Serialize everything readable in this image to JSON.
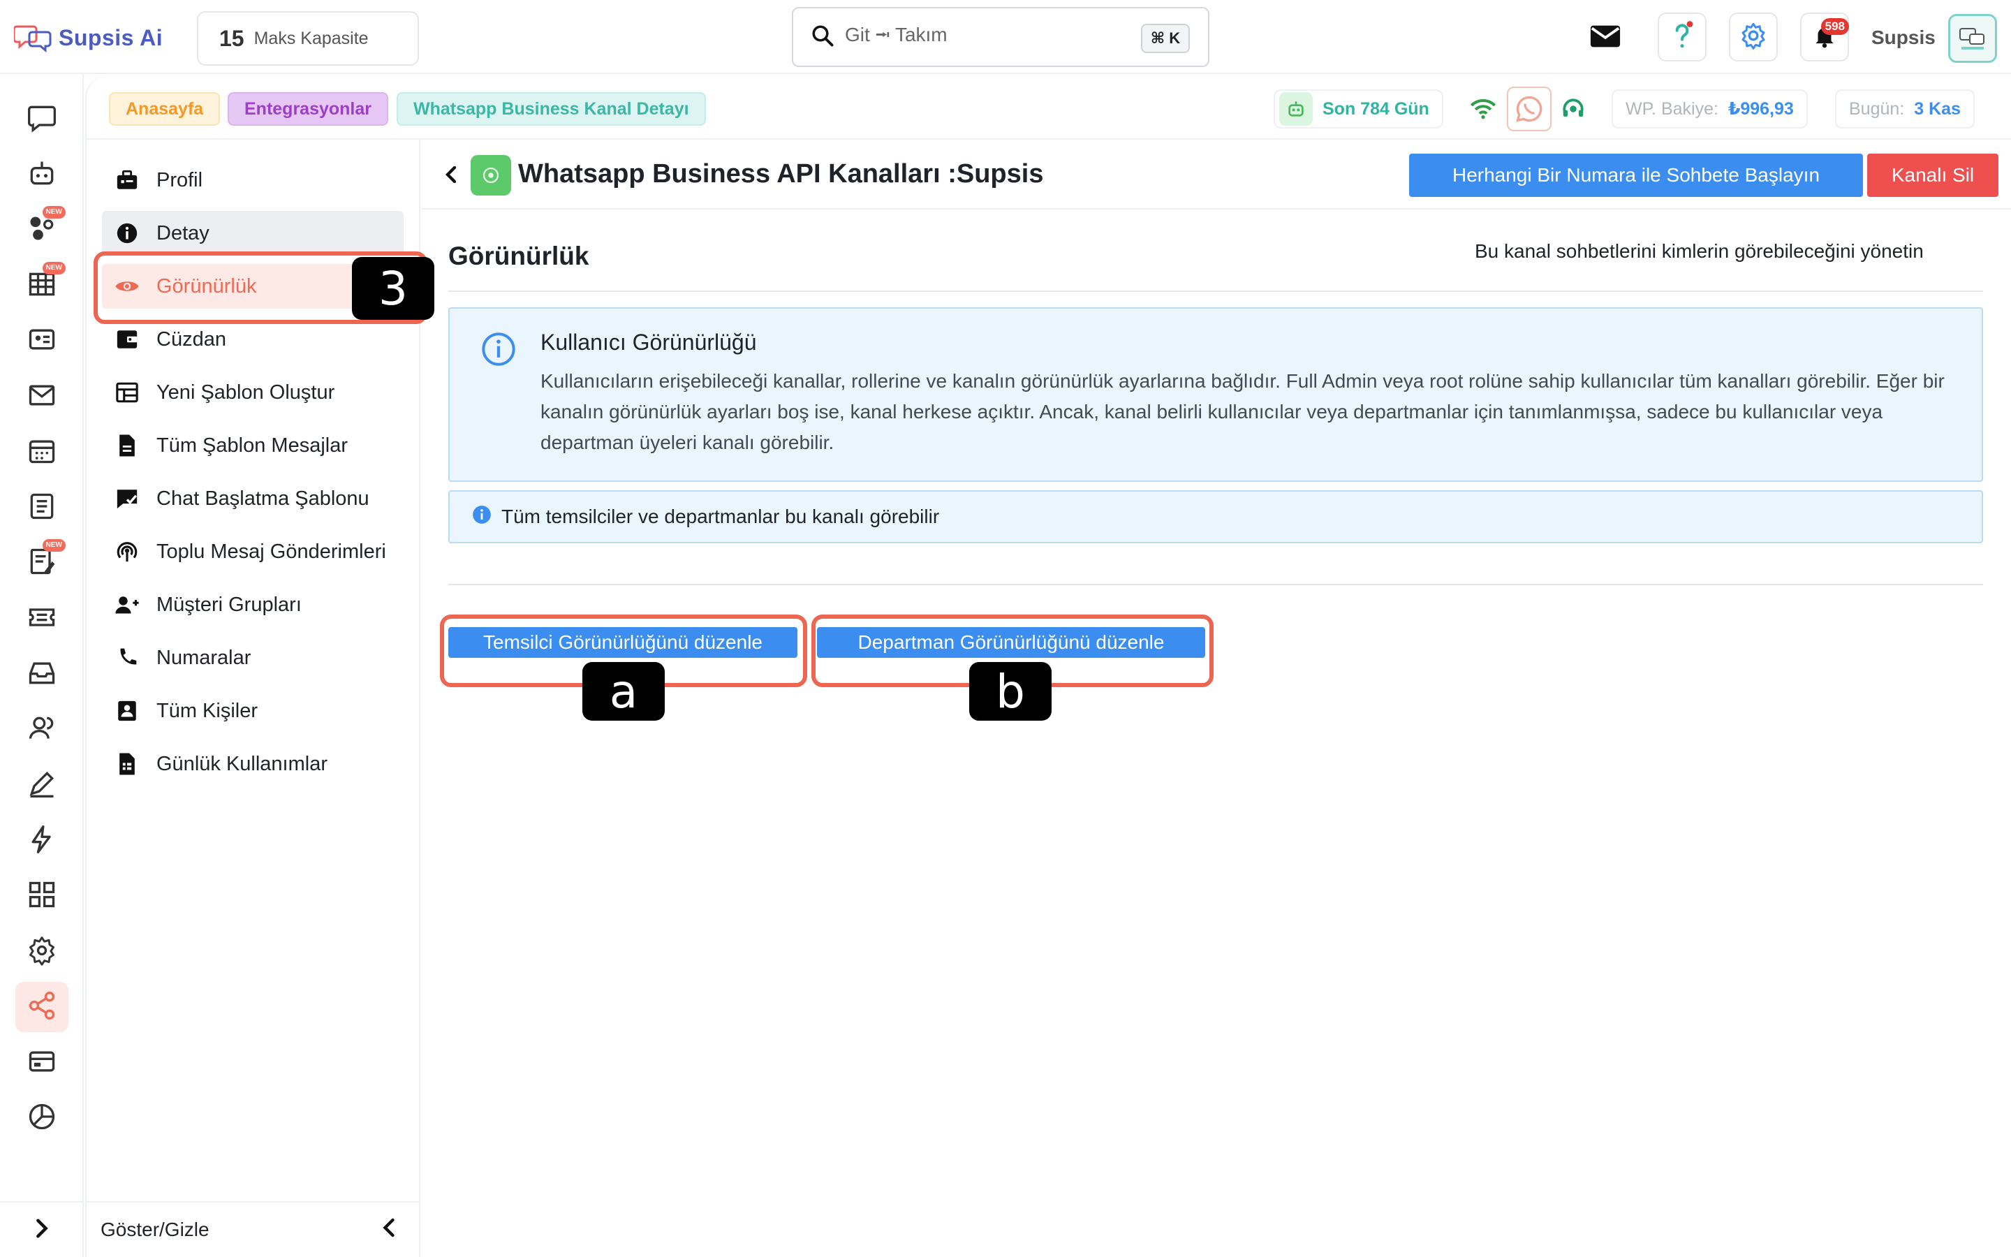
{
  "brand": {
    "name": "Supsis Ai",
    "accent": "#4b5bbf"
  },
  "capacity": {
    "value": "15",
    "label": "Maks Kapasite"
  },
  "search": {
    "value": "Git ⭲ Takım",
    "shortcut": "⌘ K",
    "icon": "search-icon"
  },
  "topbar": {
    "icons": [
      "mail-icon",
      "help-icon",
      "gear-icon",
      "bell-icon"
    ],
    "notification_count": "598",
    "org_name": "Supsis"
  },
  "rail": {
    "items": [
      {
        "icon": "chat-bubble-icon"
      },
      {
        "icon": "bot-icon"
      },
      {
        "icon": "nodes-icon",
        "badge": "NEW"
      },
      {
        "icon": "grid-table-icon",
        "badge": "NEW"
      },
      {
        "icon": "contact-card-icon"
      },
      {
        "icon": "mail-icon"
      },
      {
        "icon": "calendar-icon"
      },
      {
        "icon": "checklist-icon"
      },
      {
        "icon": "notes-icon",
        "badge": "NEW"
      },
      {
        "icon": "ticket-icon"
      },
      {
        "icon": "inbox-icon"
      },
      {
        "icon": "users-icon"
      },
      {
        "icon": "pen-icon"
      },
      {
        "icon": "lightning-icon"
      },
      {
        "icon": "apps-icon"
      },
      {
        "icon": "settings-icon"
      },
      {
        "icon": "share-icon",
        "active": true
      },
      {
        "icon": "billing-icon"
      },
      {
        "icon": "pie-chart-icon"
      }
    ],
    "expand_icon": "chevron-right-icon"
  },
  "breadcrumb": {
    "items": [
      "Anasayfa",
      "Entegrasyonlar",
      "Whatsapp Business Kanal Detayı"
    ],
    "days": "Son 784 Gün",
    "balance_label": "WP. Bakiye:",
    "balance_value": "₺996,93",
    "today_label": "Bugün:",
    "today_value": "3 Kas"
  },
  "settings_nav": {
    "items": [
      {
        "label": "Profil",
        "icon": "briefcase-icon"
      },
      {
        "label": "Detay",
        "icon": "info-icon"
      },
      {
        "label": "Görünürlük",
        "icon": "eye-icon"
      },
      {
        "label": "Cüzdan",
        "icon": "wallet-icon"
      },
      {
        "label": "Yeni Şablon Oluştur",
        "icon": "template-icon"
      },
      {
        "label": "Tüm Şablon Mesajlar",
        "icon": "document-icon"
      },
      {
        "label": "Chat Başlatma Şablonu",
        "icon": "chat-check-icon"
      },
      {
        "label": "Toplu Mesaj Gönderimleri",
        "icon": "broadcast-icon"
      },
      {
        "label": "Müşteri Grupları",
        "icon": "user-plus-icon"
      },
      {
        "label": "Numaralar",
        "icon": "phone-icon"
      },
      {
        "label": "Tüm Kişiler",
        "icon": "contact-icon"
      },
      {
        "label": "Günlük Kullanımlar",
        "icon": "usage-icon"
      }
    ],
    "footer_label": "Göster/Gizle"
  },
  "main": {
    "title": "Whatsapp Business API Kanalları :Supsis",
    "start_chat_button": "Herhangi Bir Numara ile Sohbete Başlayın",
    "delete_button": "Kanalı Sil",
    "section_title": "Görünürlük",
    "section_desc": "Bu kanal sohbetlerini kimlerin görebileceğini yönetin",
    "info_title": "Kullanıcı Görünürlüğü",
    "info_body": "Kullanıcıların erişebileceği kanallar, rollerine ve kanalın görünürlük ayarlarına bağlıdır. Full Admin veya root rolüne sahip kullanıcılar tüm kanalları görebilir. Eğer bir kanalın görünürlük ayarları boş ise, kanal herkese açıktır. Ancak, kanal belirli kullanıcılar veya departmanlar için tanımlanmışsa, sadece bu kullanıcılar veya departman üyeleri kanalı görebilir.",
    "note": "Tüm temsilciler ve departmanlar bu kanalı görebilir",
    "edit_agent_button": "Temsilci Görünürlüğünü düzenle",
    "edit_dept_button": "Departman Görünürlüğünü düzenle"
  },
  "annotations": {
    "step": "3",
    "option_a": "a",
    "option_b": "b",
    "color": "#ee6552"
  }
}
